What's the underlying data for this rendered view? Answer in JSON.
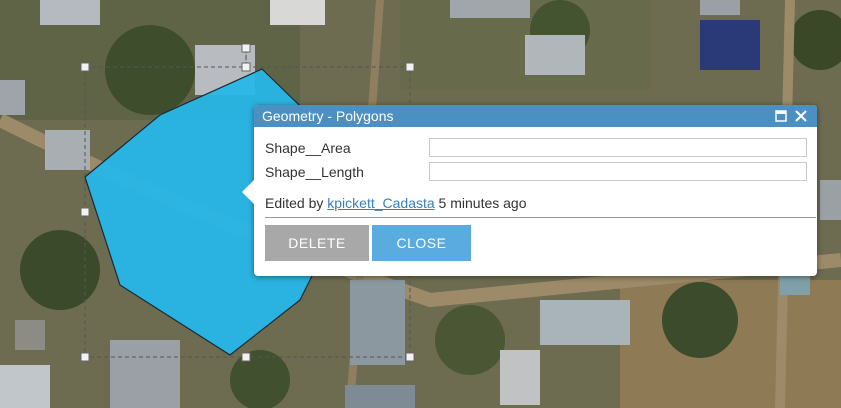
{
  "popup": {
    "title": "Geometry - Polygons",
    "fields": [
      {
        "label": "Shape__Area",
        "value": ""
      },
      {
        "label": "Shape__Length",
        "value": ""
      }
    ],
    "edited_prefix": "Edited by ",
    "edited_user": "kpickett_Cadasta",
    "edited_suffix": " 5 minutes ago",
    "delete_label": "DELETE",
    "close_label": "CLOSE",
    "maximize_icon": "maximize-icon",
    "close_icon": "close-icon"
  },
  "colors": {
    "header": "#4c8fc1",
    "polygon_fill": "#27b6e8",
    "close_button": "#5aabdf",
    "delete_button": "#a8a8a8",
    "link": "#3a7fb8"
  }
}
